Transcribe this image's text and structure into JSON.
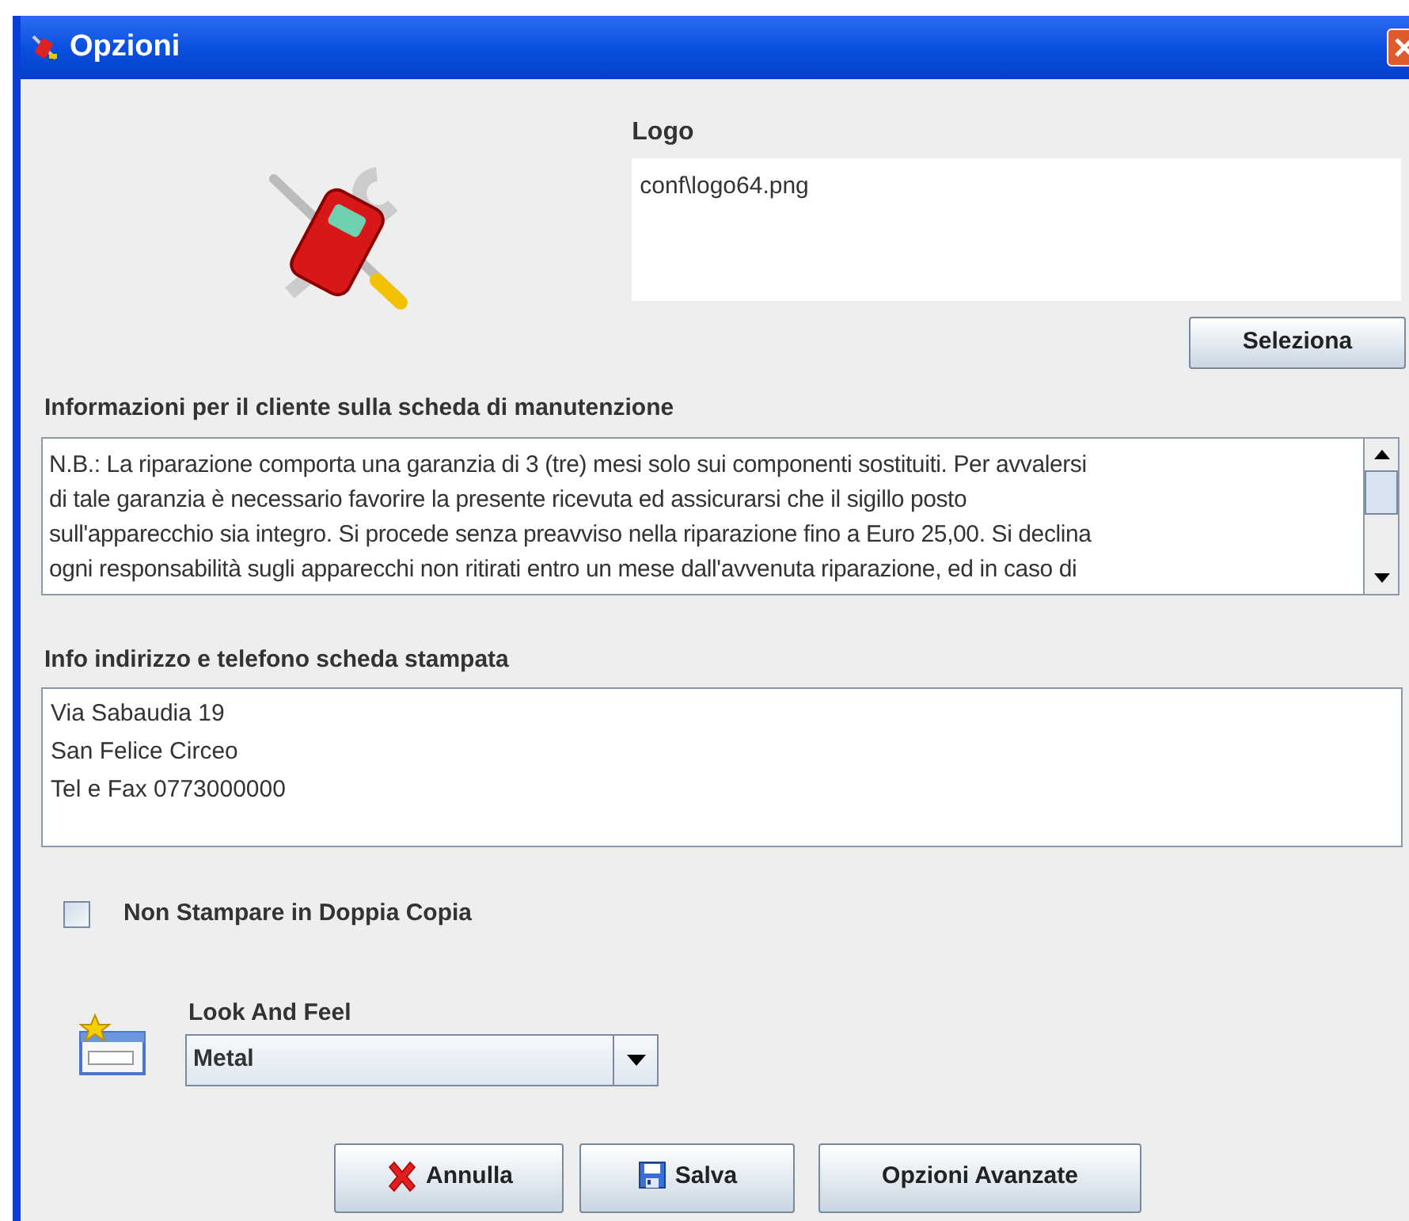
{
  "window": {
    "title": "Opzioni"
  },
  "logo": {
    "label": "Logo",
    "value": "conf\\logo64.png",
    "button": "Seleziona"
  },
  "customer_info": {
    "label": "Informazioni per il cliente sulla scheda di manutenzione",
    "lines": [
      "N.B.: La riparazione comporta una garanzia di 3 (tre) mesi solo sui componenti sostituiti. Per avvalersi",
      "di tale garanzia è necessario favorire la presente ricevuta ed assicurarsi che il sigillo posto",
      "sull'apparecchio sia integro. Si procede senza preavviso nella riparazione fino a Euro 25,00. Si declina",
      "ogni responsabilità sugli apparecchi non ritirati entro un mese dall'avvenuta riparazione, ed in caso di"
    ]
  },
  "address_info": {
    "label": "Info indirizzo e telefono scheda stampata",
    "lines": [
      "Via Sabaudia 19",
      "San Felice Circeo",
      "Tel e Fax 0773000000"
    ]
  },
  "no_double_copy": {
    "label": "Non Stampare in Doppia Copia",
    "checked": false
  },
  "look_and_feel": {
    "label": "Look And Feel",
    "value": "Metal"
  },
  "buttons": [
    {
      "kind": "cancel",
      "label": "Annulla"
    },
    {
      "kind": "save",
      "label": "Salva"
    },
    {
      "kind": "plain",
      "label": "Opzioni Avanzate"
    }
  ]
}
